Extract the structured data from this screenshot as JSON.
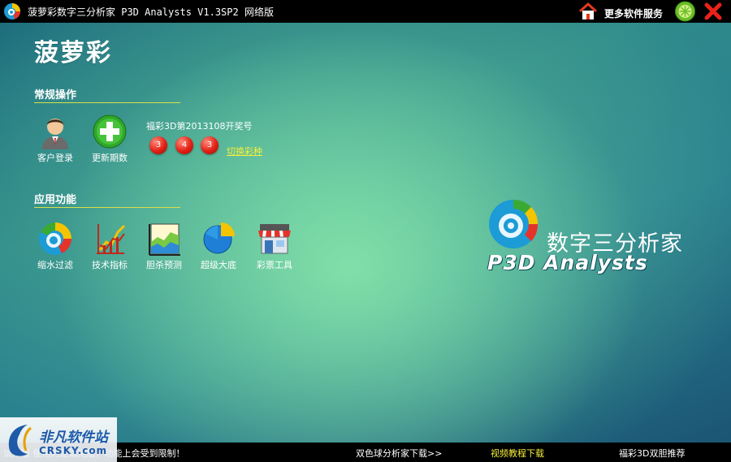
{
  "titlebar": {
    "title": "菠萝彩数字三分析家 P3D Analysts V1.3SP2 网络版",
    "more_service": "更多软件服务"
  },
  "brand": {
    "name": "菠萝彩"
  },
  "sections": {
    "general": {
      "title": "常规操作"
    },
    "apps": {
      "title": "应用功能"
    }
  },
  "general_tiles": [
    {
      "label": "客户登录",
      "icon": "user-icon"
    },
    {
      "label": "更新期数",
      "icon": "plus-icon"
    }
  ],
  "draw": {
    "title": "福彩3D第2013108开奖号",
    "balls": [
      "3",
      "4",
      "3"
    ],
    "switch_label": "切换彩种"
  },
  "app_tiles": [
    {
      "label": "缩水过滤",
      "icon": "filter-icon"
    },
    {
      "label": "技术指标",
      "icon": "indicator-chart-icon"
    },
    {
      "label": "胆杀预测",
      "icon": "forecast-chart-icon"
    },
    {
      "label": "超级大底",
      "icon": "pie-chart-icon"
    },
    {
      "label": "彩票工具",
      "icon": "store-icon"
    }
  ],
  "product": {
    "name_cn": "数字三分析家",
    "name_en": "P3D Analysts"
  },
  "statusbar": {
    "message": "试用版 使用的是试用版，功能上会受到限制！",
    "link_ssq": "双色球分析家下载>>",
    "link_video": "视频教程下载",
    "link_recommend": "福彩3D双胆推荐"
  },
  "watermark": {
    "name": "非凡软件站",
    "sub": "CRSKY.com"
  },
  "colors": {
    "accent_yellow": "#f6ef3a",
    "ball_red": "#e32015",
    "titlebar_bg": "#000000"
  }
}
